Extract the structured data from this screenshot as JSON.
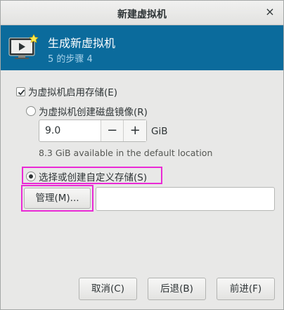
{
  "window": {
    "title": "新建虚拟机",
    "close_glyph": "×"
  },
  "banner": {
    "heading": "生成新虚拟机",
    "step": "5 的步骤 4",
    "icon": "monitor-play-icon",
    "color": "#0b6b9c"
  },
  "storage": {
    "enable_label": "为虚拟机启用存储(E)",
    "enable_checked": true,
    "create_disk_label": "为虚拟机创建磁盘镜像(R)",
    "create_disk_selected": false,
    "size_value": "9.0",
    "decrement_glyph": "−",
    "increment_glyph": "+",
    "size_unit": "GiB",
    "available_text": "8.3 GiB available in the default location",
    "custom_label": "选择或创建自定义存储(S)",
    "custom_selected": true,
    "manage_label": "管理(M)...",
    "path_value": ""
  },
  "footer": {
    "cancel_label": "取消(C)",
    "back_label": "后退(B)",
    "forward_label": "前进(F)"
  },
  "colors": {
    "highlight": "#ea2ad5"
  }
}
